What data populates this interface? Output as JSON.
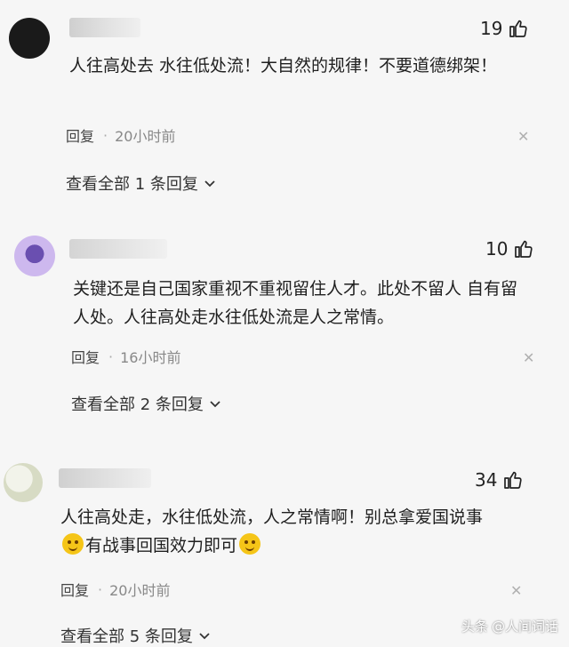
{
  "comments": [
    {
      "likes": "19",
      "text": "人往高处去 水往低处流！大自然的规律！不要道德绑架！",
      "reply_label": "回复",
      "separator": "·",
      "time": "20小时前",
      "view_all": "查看全部 1 条回复"
    },
    {
      "likes": "10",
      "text": "关键还是自己国家重视不重视留住人才。此处不留人 自有留人处。人往高处走水往低处流是人之常情。",
      "reply_label": "回复",
      "separator": "·",
      "time": "16小时前",
      "view_all": "查看全部 2 条回复"
    },
    {
      "likes": "34",
      "text_line1": "人往高处走，水往低处流，人之常情啊！别总拿爱国说事",
      "text_line2": "有战事回国效力即可",
      "reply_label": "回复",
      "separator": "·",
      "time": "20小时前",
      "view_all": "查看全部 5 条回复"
    }
  ],
  "watermark": {
    "brand": "头条",
    "handle": "@人间词话"
  },
  "icons": {
    "like": "thumbs-up-icon",
    "close": "close-icon",
    "expand": "chevron-down-icon",
    "emoji": "smiley-emoji-icon"
  },
  "colors": {
    "background": "#f6f6f6",
    "text": "#1f1f1f",
    "muted": "#888888"
  }
}
